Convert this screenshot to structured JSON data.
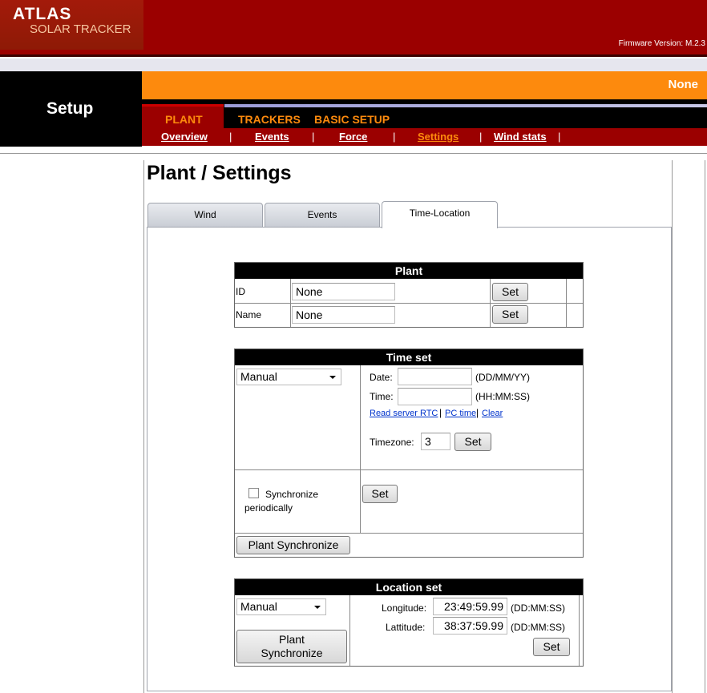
{
  "brand": {
    "line1": "ATLAS",
    "line2": "SOLAR TRACKER"
  },
  "firmware": "Firmware Version: M.2.3",
  "section_title": "Setup",
  "status_value": "None",
  "main_tabs": [
    "PLANT",
    "TRACKERS",
    "BASIC SETUP"
  ],
  "sub_nav": [
    "Overview",
    "Events",
    "Force",
    "Settings",
    "Wind stats"
  ],
  "separator": "|",
  "page_title": "Plant / Settings",
  "content_tabs": [
    "Wind",
    "Events",
    "Time-Location"
  ],
  "active_tab": "Time-Location",
  "plant": {
    "header": "Plant",
    "id_label": "ID",
    "id_value": "None",
    "name_label": "Name",
    "name_value": "None",
    "set_label": "Set"
  },
  "time_set": {
    "header": "Time set",
    "mode": "Manual",
    "date_label": "Date:",
    "date_value": "",
    "date_format": "(DD/MM/YY)",
    "time_label": "Time:",
    "time_value": "",
    "time_format": "(HH:MM:SS)",
    "links": [
      "Read server RTC",
      "PC time",
      "Clear"
    ],
    "timezone_label": "Timezone:",
    "timezone_value": "3",
    "set_label": "Set",
    "sync_label_1": "Synchronize",
    "sync_label_2": "periodically",
    "sync_checked": false,
    "plant_sync_label": "Plant Synchronize"
  },
  "location_set": {
    "header": "Location set",
    "mode": "Manual",
    "plant_sync_line1": "Plant",
    "plant_sync_line2": "Synchronize",
    "longitude_label": "Longitude:",
    "longitude_value": "23:49:59.99",
    "latitude_label": "Lattitude:",
    "latitude_value": "38:37:59.99",
    "format": "(DD:MM:SS)",
    "set_label": "Set"
  }
}
